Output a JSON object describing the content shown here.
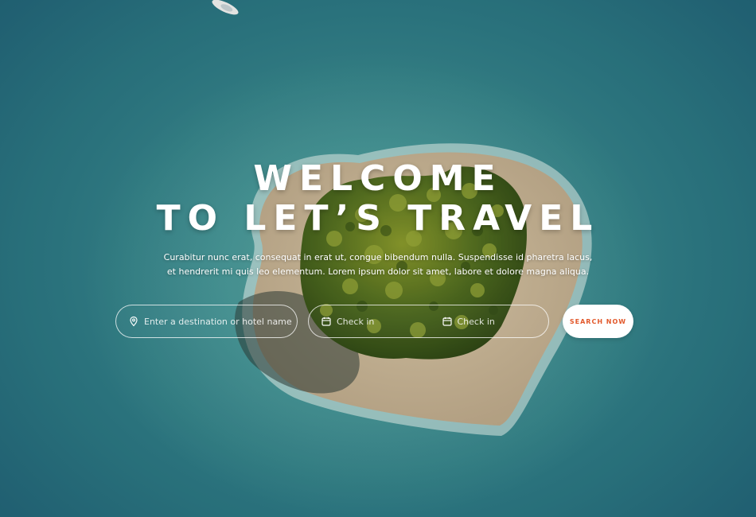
{
  "hero": {
    "title_line1": "WELCOME",
    "title_line2": "TO LET’S TRAVEL",
    "subtitle": "Curabitur nunc erat, consequat in erat ut, congue bibendum nulla. Suspendisse id pharetra lacus, et hendrerit mi quis leo elementum. Lorem ipsum dolor sit amet, labore et dolore magna aliqua."
  },
  "search": {
    "destination_placeholder": "Enter a destination or hotel name",
    "checkin_placeholder": "Check in",
    "checkout_placeholder": "Check in",
    "button_label": "SEARCH NOW"
  },
  "icons": {
    "destination": "map-pin-icon",
    "checkin": "calendar-icon",
    "checkout": "calendar-icon"
  },
  "colors": {
    "accent": "#e2582b",
    "water": "#2d7a84",
    "sand": "#cbb99a",
    "foliage": "#4f6b1f"
  }
}
